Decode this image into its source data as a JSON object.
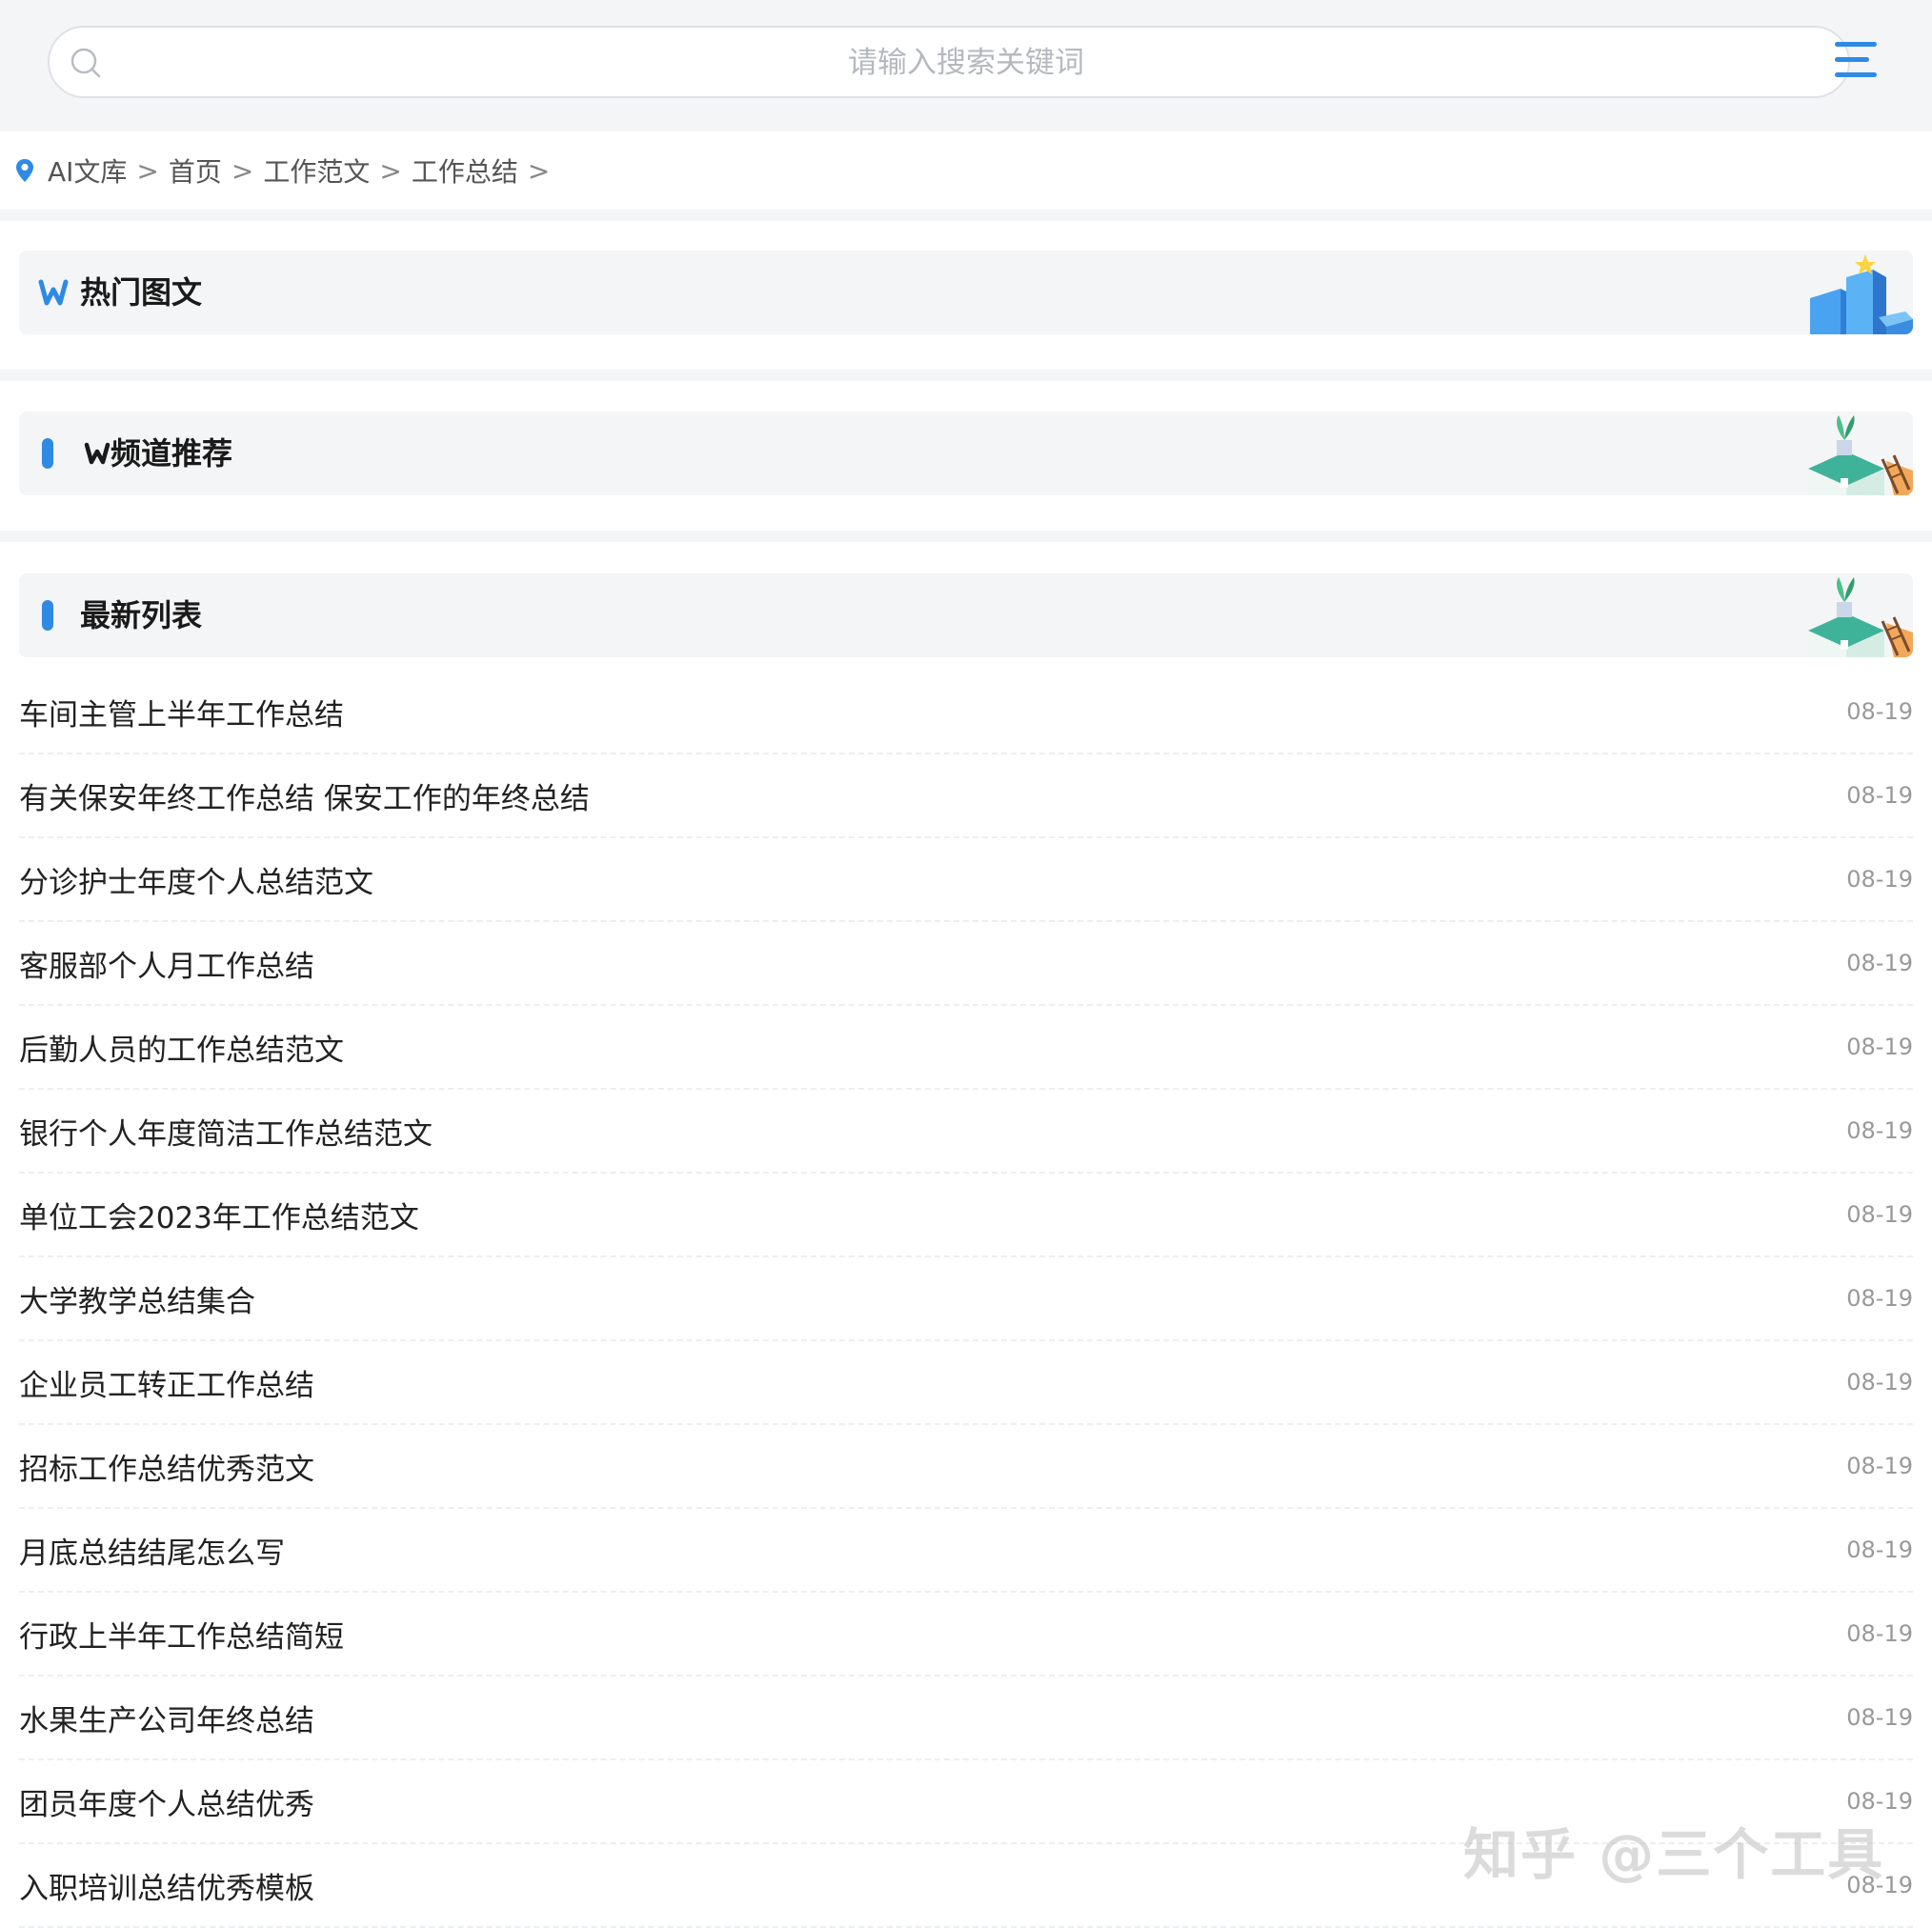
{
  "search": {
    "placeholder": "请输入搜索关键词"
  },
  "breadcrumb": {
    "items": [
      "AI文库",
      "首页",
      "工作范文",
      "工作总结"
    ],
    "separator": ">"
  },
  "sections": {
    "hot": {
      "title": "热门图文"
    },
    "channel": {
      "title": "频道推荐"
    },
    "latest": {
      "title": "最新列表"
    }
  },
  "list": {
    "items": [
      {
        "title": "车间主管上半年工作总结",
        "date": "08-19"
      },
      {
        "title": "有关保安年终工作总结 保安工作的年终总结",
        "date": "08-19"
      },
      {
        "title": "分诊护士年度个人总结范文",
        "date": "08-19"
      },
      {
        "title": "客服部个人月工作总结",
        "date": "08-19"
      },
      {
        "title": "后勤人员的工作总结范文",
        "date": "08-19"
      },
      {
        "title": "银行个人年度简洁工作总结范文",
        "date": "08-19"
      },
      {
        "title": "单位工会2023年工作总结范文",
        "date": "08-19"
      },
      {
        "title": "大学教学总结集合",
        "date": "08-19"
      },
      {
        "title": "企业员工转正工作总结",
        "date": "08-19"
      },
      {
        "title": "招标工作总结优秀范文",
        "date": "08-19"
      },
      {
        "title": "月底总结结尾怎么写",
        "date": "08-19"
      },
      {
        "title": "行政上半年工作总结简短",
        "date": "08-19"
      },
      {
        "title": "水果生产公司年终总结",
        "date": "08-19"
      },
      {
        "title": "团员年度个人总结优秀",
        "date": "08-19"
      },
      {
        "title": "入职培训总结优秀模板",
        "date": "08-19"
      }
    ]
  },
  "watermark": "知乎 @三个工具",
  "colors": {
    "accent": "#2f8ae4",
    "background_gray": "#f4f5f7",
    "text": "#222222",
    "muted": "#999999"
  },
  "icons": {
    "search": "search-icon",
    "menu": "menu-icon",
    "location": "location-pin-icon",
    "brand": "w-logo-icon",
    "hot_deco": "blue-cubes-star-icon",
    "channel_deco": "house-plant-ladder-icon"
  }
}
